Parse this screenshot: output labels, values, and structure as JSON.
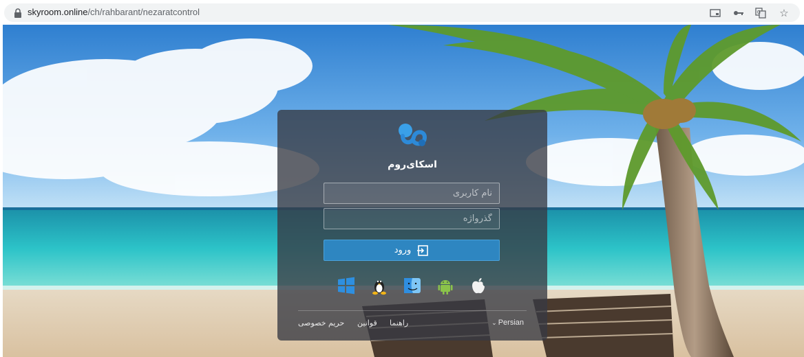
{
  "browser": {
    "url_host": "skyroom.online",
    "url_path": "/ch/rahbarant/nezaratcontrol",
    "icons": [
      "lock-icon",
      "cast-icon",
      "key-icon",
      "translate-icon",
      "star-icon"
    ]
  },
  "login": {
    "brand_name": "اسکای‌روم",
    "username_placeholder": "نام کاربری",
    "password_placeholder": "گذرواژه",
    "login_label": "ورود",
    "accent_color": "#2e86c1",
    "platforms": [
      "windows-icon",
      "linux-icon",
      "macos-finder-icon",
      "android-icon",
      "apple-icon"
    ]
  },
  "footer": {
    "help": "راهنما",
    "rules": "قوانین",
    "privacy": "حریم خصوصی",
    "language": "Persian"
  }
}
